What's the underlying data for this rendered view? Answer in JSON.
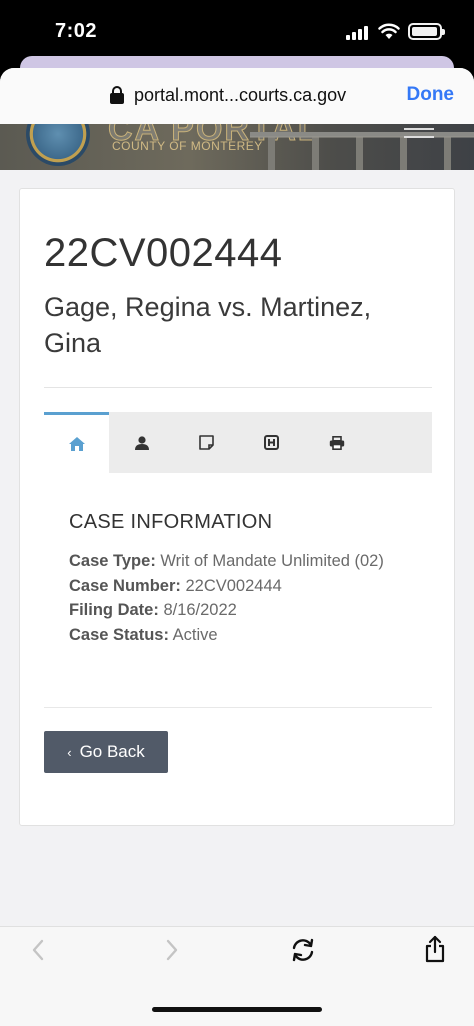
{
  "status_bar": {
    "time": "7:02"
  },
  "browser": {
    "url": "portal.mont...courts.ca.gov",
    "done_label": "Done"
  },
  "banner": {
    "title": "CA PORTAL",
    "subtitle": "COUNTY OF MONTEREY",
    "seal_text": "COUNTY OF MONTEREY"
  },
  "case": {
    "number": "22CV002444",
    "parties": "Gage, Regina vs. Martinez, Gina"
  },
  "tabs": [
    {
      "icon": "home-icon",
      "active": true
    },
    {
      "icon": "person-icon",
      "active": false
    },
    {
      "icon": "note-icon",
      "active": false
    },
    {
      "icon": "hearing-icon",
      "active": false
    },
    {
      "icon": "print-icon",
      "active": false
    }
  ],
  "case_information": {
    "heading": "CASE INFORMATION",
    "case_type_label": "Case Type:",
    "case_type_value": "Writ of Mandate Unlimited (02)",
    "case_number_label": "Case Number:",
    "case_number_value": "22CV002444",
    "filing_date_label": "Filing Date:",
    "filing_date_value": "8/16/2022",
    "case_status_label": "Case Status:",
    "case_status_value": "Active"
  },
  "go_back_label": "Go Back",
  "colors": {
    "accent": "#3478f6",
    "tab_active": "#5aa0d0",
    "button": "#515a68"
  }
}
